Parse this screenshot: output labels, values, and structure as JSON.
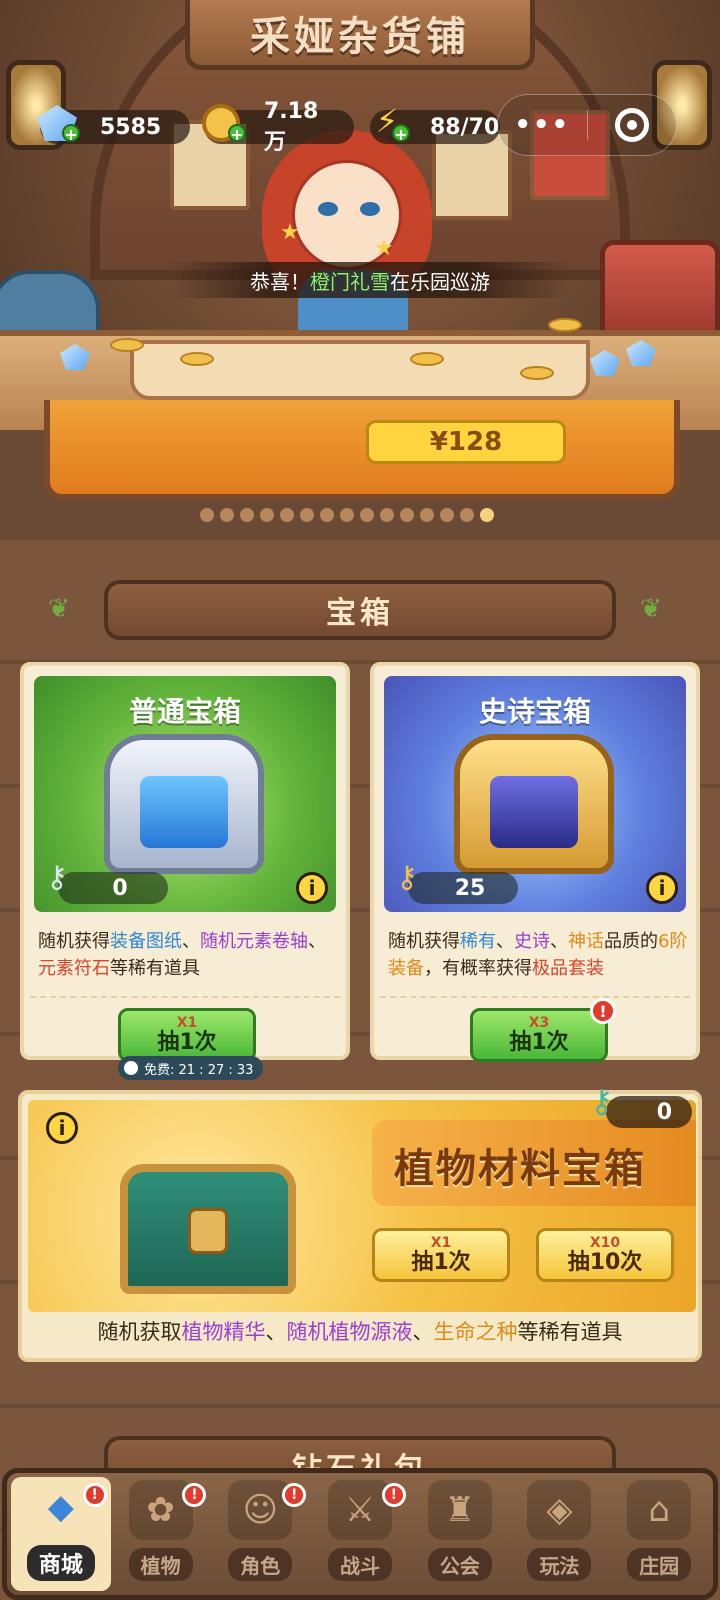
{
  "shop": {
    "sign": "采娅杂货铺"
  },
  "resources": {
    "diamond": {
      "value": "5585",
      "icon": "diamond-icon"
    },
    "gold": {
      "value": "7.18万",
      "icon": "gold-coin-icon"
    },
    "energy": {
      "value": "88/70",
      "icon": "lightning-icon"
    }
  },
  "miniapp": {
    "more": "•••"
  },
  "announcement": {
    "prefix": "恭喜！",
    "name": "橙门礼雪",
    "suffix": "在乐园巡游"
  },
  "banner": {
    "price": "¥128"
  },
  "carousel": {
    "count": 15,
    "active_index": 14
  },
  "chest_section": {
    "title": "宝箱"
  },
  "normal_chest": {
    "title": "普通宝箱",
    "key_count": "0",
    "desc": [
      {
        "t": "随机获得",
        "c": ""
      },
      {
        "t": "装备图纸",
        "c": "blue"
      },
      {
        "t": "、",
        "c": ""
      },
      {
        "t": "随机元素卷轴",
        "c": "purple"
      },
      {
        "t": "、",
        "c": ""
      },
      {
        "t": "元素符石",
        "c": "red"
      },
      {
        "t": "等稀有道具",
        "c": ""
      }
    ],
    "button": {
      "cost": "X1",
      "label": "抽1次"
    },
    "free_timer": "免费: 21 : 27 : 33"
  },
  "epic_chest": {
    "title": "史诗宝箱",
    "key_count": "25",
    "desc": [
      {
        "t": "随机获得",
        "c": ""
      },
      {
        "t": "稀有",
        "c": "blue"
      },
      {
        "t": "、",
        "c": ""
      },
      {
        "t": "史诗",
        "c": "purple"
      },
      {
        "t": "、",
        "c": ""
      },
      {
        "t": "神话",
        "c": "orange"
      },
      {
        "t": "品质的",
        "c": ""
      },
      {
        "t": "6阶装备",
        "c": "orange"
      },
      {
        "t": "，有概率获得",
        "c": ""
      },
      {
        "t": "极品套装",
        "c": "red"
      }
    ],
    "button": {
      "cost": "X3",
      "label": "抽1次"
    },
    "alert": "!"
  },
  "plant_chest": {
    "title": "植物材料宝箱",
    "key_count": "0",
    "button1": {
      "cost": "X1",
      "label": "抽1次"
    },
    "button2": {
      "cost": "X10",
      "label": "抽10次"
    },
    "desc": [
      {
        "t": "随机获取",
        "c": ""
      },
      {
        "t": "植物精华",
        "c": "purple"
      },
      {
        "t": "、",
        "c": ""
      },
      {
        "t": "随机植物源液",
        "c": "purple"
      },
      {
        "t": "、",
        "c": ""
      },
      {
        "t": "生命之种",
        "c": "orange"
      },
      {
        "t": "等稀有道具",
        "c": ""
      }
    ]
  },
  "next_section": {
    "title": "钻石礼包"
  },
  "nav": [
    {
      "label": "商城",
      "icon": "shop-icon",
      "active": true,
      "alert": true
    },
    {
      "label": "植物",
      "icon": "plant-icon",
      "active": false,
      "alert": true
    },
    {
      "label": "角色",
      "icon": "character-icon",
      "active": false,
      "alert": true
    },
    {
      "label": "战斗",
      "icon": "battle-icon",
      "active": false,
      "alert": true
    },
    {
      "label": "公会",
      "icon": "guild-icon",
      "active": false,
      "alert": false
    },
    {
      "label": "玩法",
      "icon": "gameplay-icon",
      "active": false,
      "alert": false
    },
    {
      "label": "庄园",
      "icon": "manor-icon",
      "active": false,
      "alert": false
    }
  ],
  "colors": {
    "accent_green": "#4ab737",
    "gold": "#f5c43a",
    "alert": "#e23a2c"
  }
}
